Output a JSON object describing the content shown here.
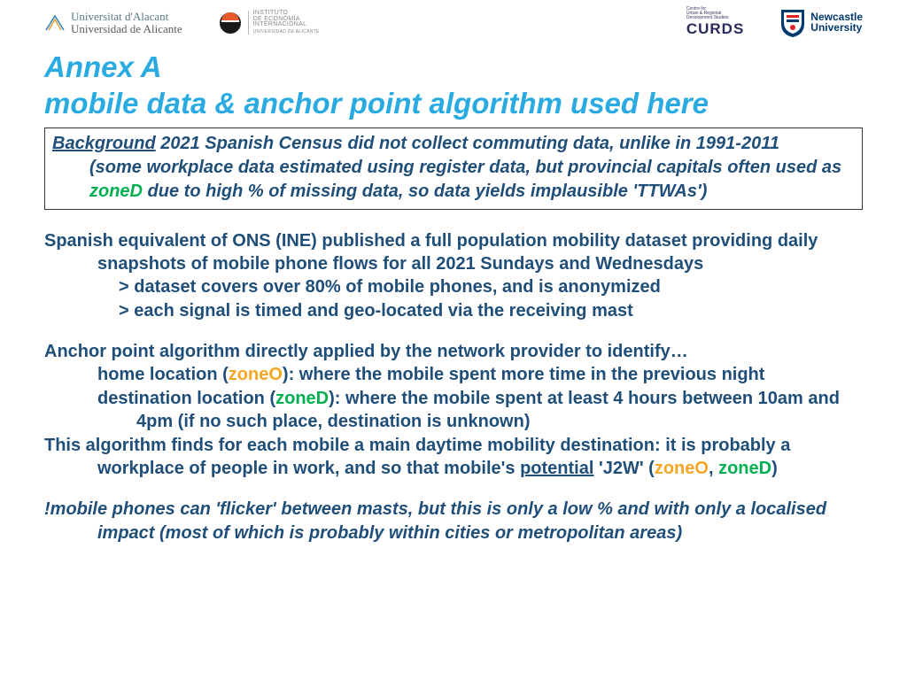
{
  "logos": {
    "ua_line1": "Universitat d'Alacant",
    "ua_line2": "Universidad de Alicante",
    "iei_l1": "INSTITUTO",
    "iei_l2": "DE ECONOMÍA",
    "iei_l3": "INTERNACIONAL",
    "iei_l4": "UNIVERSIDAD DE ALICANTE",
    "curds_tiny1": "Centre for",
    "curds_tiny2": "Urban & Regional",
    "curds_tiny3": "Development Studies",
    "curds": "CURDS",
    "nu_l1": "Newcastle",
    "nu_l2": "University"
  },
  "title_l1": "Annex A",
  "title_l2": "mobile data & anchor point algorithm used here",
  "box": {
    "bg_label": "Background",
    "bg_rest": " 2021 Spanish Census did not collect commuting data, unlike in 1991-2011",
    "line2a": "(some workplace data estimated using register data, but provincial capitals often used as ",
    "zoneD": "zoneD",
    "line2b": " due to high % of missing data, so data yields implausible 'TTWAs')"
  },
  "body": {
    "p1": "Spanish equivalent of ONS (INE) published a full population mobility dataset providing daily snapshots of mobile phone flows for all 2021 Sundays and Wednesdays",
    "p1a": "> dataset covers over 80% of mobile phones, and is anonymized",
    "p1b": "> each signal is timed and geo-located via the receiving mast",
    "p2": "Anchor point algorithm directly applied by the network provider to identify…",
    "p2a_pre": "home location (",
    "zoneO": "zoneO",
    "p2a_post": "): where the mobile spent more time in the previous night",
    "p2b_pre": "destination location (",
    "zoneD": "zoneD",
    "p2b_post": "): where the mobile spent at least 4 hours between 10am and 4pm (if no such place, destination is unknown)",
    "p3a": "This algorithm finds for each mobile a main daytime mobility destination: it is probably a workplace of people in work, and so that mobile's ",
    "p3_pot": "potential",
    "p3b": " 'J2W' (",
    "p3c": ", ",
    "p3d": ")",
    "p4": "!mobile phones can 'flicker' between masts, but this is only a low % and with only a localised impact (most of which is probably within cities or metropolitan areas)"
  }
}
